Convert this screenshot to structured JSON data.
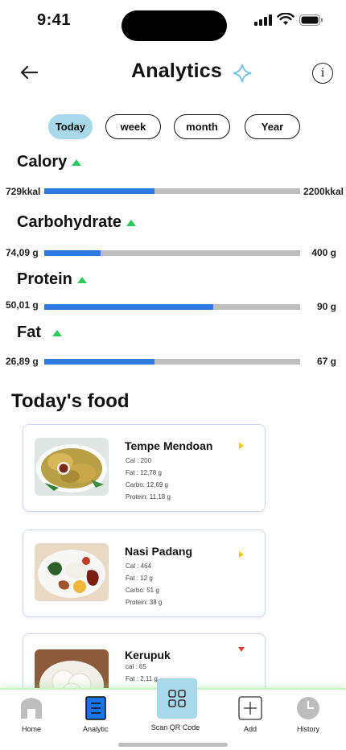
{
  "status": {
    "time": "9:41"
  },
  "header": {
    "title": "Analytics"
  },
  "tabs": [
    {
      "label": "Today",
      "active": true
    },
    {
      "label": "week",
      "active": false
    },
    {
      "label": "month",
      "active": false
    },
    {
      "label": "Year",
      "active": false
    }
  ],
  "nutrients": [
    {
      "name": "Calory",
      "current": "729kkal",
      "target": "2200kkal",
      "progress": 0.43
    },
    {
      "name": "Carbohydrate",
      "current": "74,09 g",
      "target": "400 g",
      "progress": 0.22
    },
    {
      "name": "Protein",
      "current": "50,01 g",
      "target": "90 g",
      "progress": 0.66
    },
    {
      "name": "Fat",
      "current": "26,89 g",
      "target": "67 g",
      "progress": 0.43
    }
  ],
  "food_section": {
    "title": "Today's food"
  },
  "foods": [
    {
      "name": "Tempe Mendoan",
      "lines": [
        "Cal : 200",
        "Fat : 12,78 g",
        "Carbo: 12,69 g",
        "Protein: 11,18 g"
      ],
      "indicator": "right"
    },
    {
      "name": "Nasi Padang",
      "lines": [
        "Cal : 464",
        "Fat : 12 g",
        "Carbo: 51 g",
        "Protein: 38 g"
      ],
      "indicator": "right"
    },
    {
      "name": "Kerupuk",
      "lines": [
        "cal : 65",
        "Fat : 2,11 g"
      ],
      "indicator": "down"
    }
  ],
  "nav": {
    "home": "Home",
    "analytic": "Analytic",
    "scan": "Scan QR Code",
    "add": "Add",
    "history": "History"
  },
  "colors": {
    "accent": "#a8d8ea",
    "bar_fill": "#2d7be3",
    "bar_track": "#bdbdbd",
    "up": "#2ec95c",
    "down": "#e33b2e",
    "arrow": "#f2c500"
  }
}
